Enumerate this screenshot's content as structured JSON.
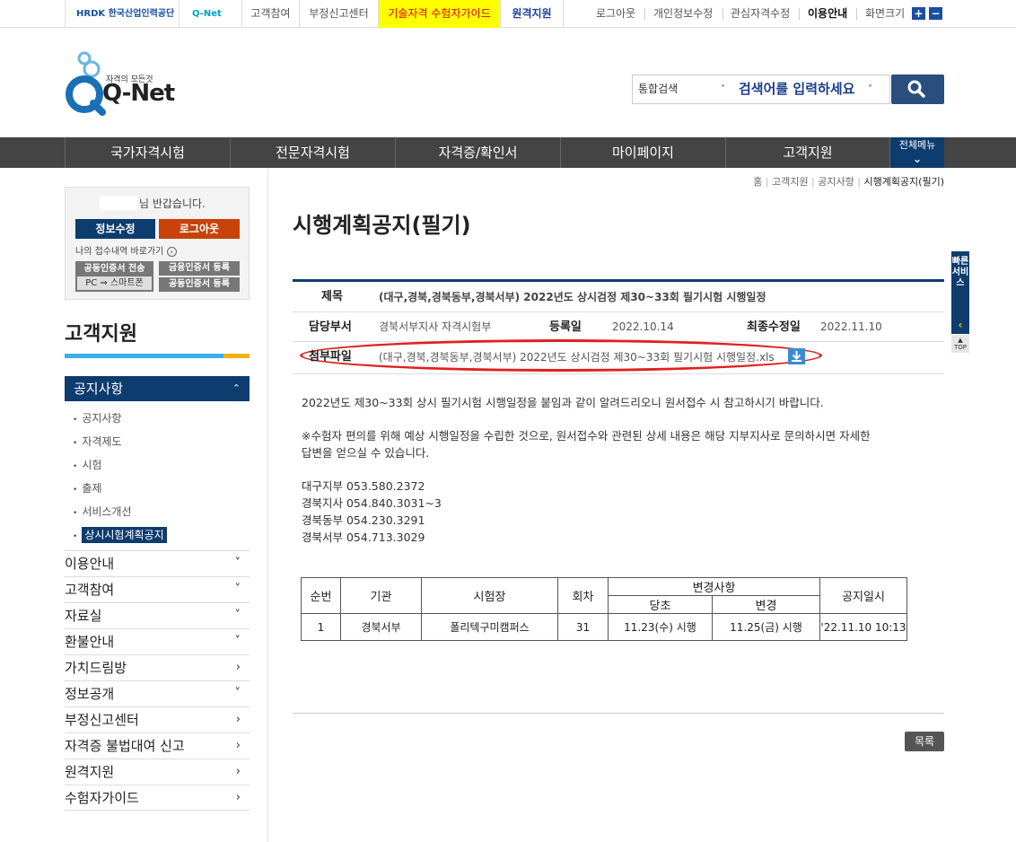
{
  "topbar": {
    "hrdk_label": "HRDK 한국산업인력공단",
    "qnet_small": "Q-Net",
    "links": [
      "고객참여",
      "부정신고센터",
      "기술자격 수험자가이드",
      "원격지원"
    ],
    "right_links": [
      "로그아웃",
      "개인정보수정",
      "관심자격수정",
      "이용안내",
      "화면크기"
    ],
    "zoom_in": "+",
    "zoom_out": "−"
  },
  "header": {
    "logo_tagline": "자격의 모든것",
    "logo_text": "Q-Net",
    "search_scope": "통합검색",
    "search_placeholder": "검색어를 입력하세요"
  },
  "gnb": {
    "items": [
      "국가자격시험",
      "전문자격시험",
      "자격증/확인서",
      "마이페이지",
      "고객지원"
    ],
    "all_menu": "전체메뉴"
  },
  "login_box": {
    "greeting": "님 반갑습니다.",
    "edit_info": "정보수정",
    "logout": "로그아웃",
    "my_apply": "나의 접수내역 바로가기",
    "cert_transfer": "공동인증서 전송",
    "pc_smartphone": "PC ⇒ 스마트폰",
    "fin_cert": "금융인증서 등록",
    "joint_cert": "공동인증서 등록"
  },
  "lnb": {
    "title": "고객지원",
    "active_section": "공지사항",
    "subitems": [
      "공지사항",
      "자격제도",
      "시험",
      "출제",
      "서비스개선",
      "상시시험계획공지"
    ],
    "sections": [
      {
        "label": "이용안내",
        "arrow": "˅"
      },
      {
        "label": "고객참여",
        "arrow": "˅"
      },
      {
        "label": "자료실",
        "arrow": "˅"
      },
      {
        "label": "환불안내",
        "arrow": "˅"
      },
      {
        "label": "가치드림방",
        "arrow": "›"
      },
      {
        "label": "정보공개",
        "arrow": "˅"
      },
      {
        "label": "부정신고센터",
        "arrow": "›"
      },
      {
        "label": "자격증 불법대여 신고",
        "arrow": "›"
      },
      {
        "label": "원격지원",
        "arrow": "›"
      },
      {
        "label": "수험자가이드",
        "arrow": "›"
      }
    ]
  },
  "breadcrumb": [
    "홈",
    "고객지원",
    "공지사항",
    "시행계획공지(필기)"
  ],
  "page_title": "시행계획공지(필기)",
  "article": {
    "subject_label": "제목",
    "subject": "(대구,경북,경북동부,경북서부) 2022년도 상시검정 제30~33회 필기시험 시행일정",
    "dept_label": "담당부서",
    "dept": "경북서부지사 자격시험부",
    "reg_label": "등록일",
    "reg_date": "2022.10.14",
    "mod_label": "최종수정일",
    "mod_date": "2022.11.10",
    "file_label": "첨부파일",
    "file_name": "(대구,경북,경북동부,경북서부) 2022년도 상시검정 제30~33회 필기시험 시행일정.xls",
    "body_p1": "2022년도 제30~33회 상시 필기시험 시행일정을 붙임과 같이 알려드리오니 원서접수 시 참고하시기 바랍니다.",
    "body_p2a": "※수험자 편의를 위해 예상 시행일정을 수립한 것으로, 원서접수와 관련된 상세 내용은 해당 지부지사로 문의하시면 자세한",
    "body_p2b": "답변을 얻으실 수 있습니다.",
    "contacts": [
      "대구지부 053.580.2372",
      "경북지사 054.840.3031~3",
      "경북동부 054.230.3291",
      "경북서부 054.713.3029"
    ]
  },
  "table": {
    "headers": [
      "순번",
      "기관",
      "시험장",
      "회차",
      "변경사항",
      "공지일시"
    ],
    "sub_headers": [
      "당초",
      "변경"
    ],
    "rows": [
      [
        "1",
        "경북서부",
        "폴리텍구미캠퍼스",
        "31",
        "11.23(수) 시행",
        "11.25(금) 시행",
        "'22.11.10 10:13"
      ]
    ]
  },
  "list_button": "목록",
  "quick": {
    "label": "빠른서비스",
    "top": "TOP"
  },
  "colors": {
    "navy": "#0d3c6e",
    "orange": "#c8420a",
    "yellow": "#ffff00",
    "accent_blue": "#3bb0e6",
    "highlight": "#e02020"
  }
}
